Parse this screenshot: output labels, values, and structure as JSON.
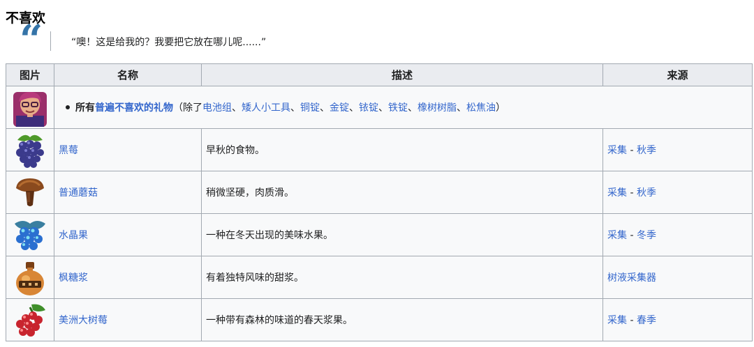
{
  "section": {
    "title": "不喜欢",
    "quote": "“噢！这是给我的？我要把它放在哪儿呢......”"
  },
  "table": {
    "headers": [
      "图片",
      "名称",
      "描述",
      "来源"
    ],
    "note_row": {
      "prefix_bold": "所有",
      "link_text": "普遍不喜欢的礼物",
      "open_paren": "（除了",
      "exceptions": [
        "电池组",
        "矮人小工具",
        "铜锭",
        "金锭",
        "铱锭",
        "铁锭",
        "橡树树脂",
        "松焦油"
      ],
      "separator": "、",
      "close_paren": "）"
    },
    "rows": [
      {
        "icon": "blackberry-icon",
        "name": "黑莓",
        "desc": "早秋的食物。",
        "source": "采集",
        "dash": "-",
        "season": "秋季"
      },
      {
        "icon": "common-mushroom-icon",
        "name": "普通蘑菇",
        "desc": "稍微坚硬，肉质滑。",
        "source": "采集",
        "dash": "-",
        "season": "秋季"
      },
      {
        "icon": "crystal-fruit-icon",
        "name": "水晶果",
        "desc": "一种在冬天出现的美味水果。",
        "source": "采集",
        "dash": "-",
        "season": "冬季"
      },
      {
        "icon": "maple-syrup-icon",
        "name": "枫糖浆",
        "desc": "有着独特风味的甜浆。",
        "source": "树液采集器",
        "dash": "",
        "season": ""
      },
      {
        "icon": "salmonberry-icon",
        "name": "美洲大树莓",
        "desc": "一种带有森林的味道的春天浆果。",
        "source": "采集",
        "dash": "-",
        "season": "春季"
      }
    ]
  },
  "colors": {
    "link": "#3366cc",
    "quote": "#3574a8",
    "header_bg": "#eaecf0",
    "cell_bg": "#f8f9fa",
    "border": "#a2a9b1"
  }
}
